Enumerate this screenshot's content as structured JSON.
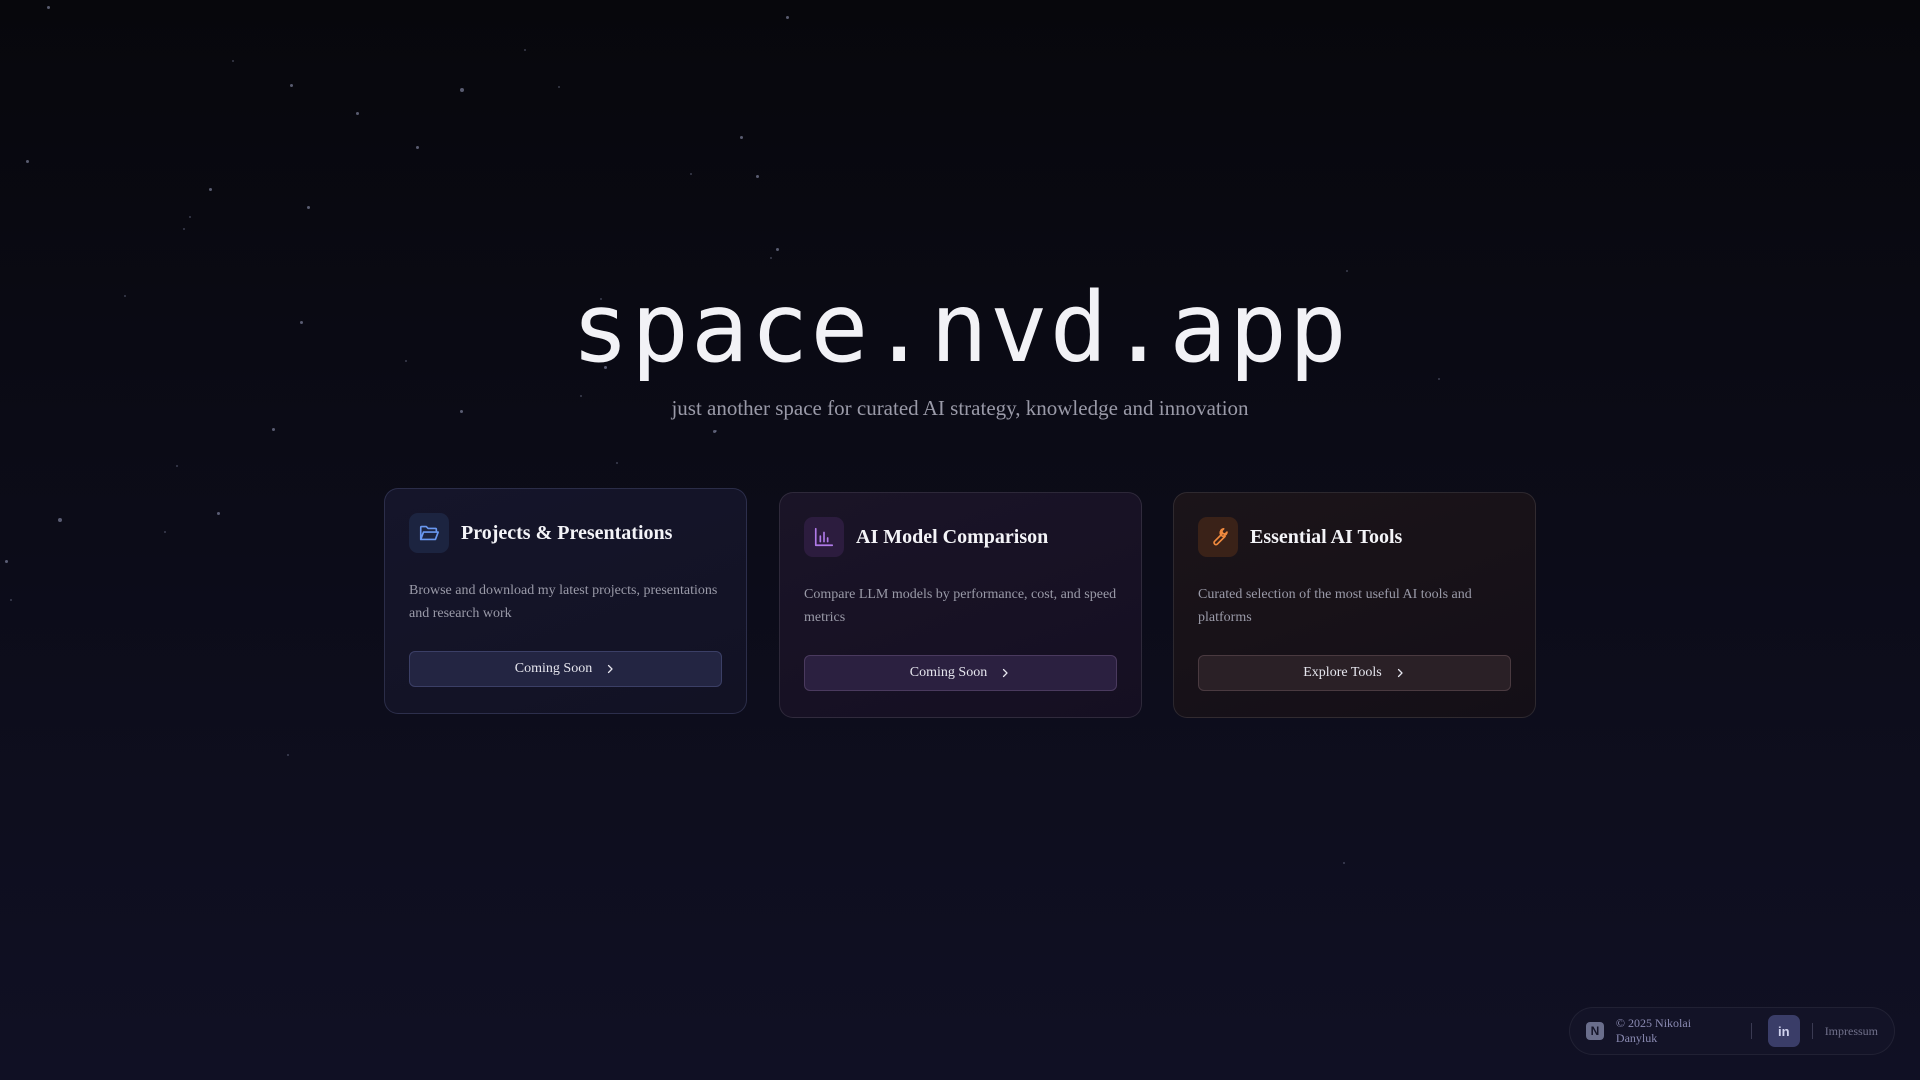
{
  "hero": {
    "title": "space.nvd.app",
    "subtitle": "just another space for curated AI strategy, knowledge and innovation"
  },
  "cards": [
    {
      "title": "Projects & Presentations",
      "description": "Browse and download my latest projects, presentations and research work",
      "button_label": "Coming Soon",
      "icon": "folder-open-icon",
      "accent": "#6a98f0"
    },
    {
      "title": "AI Model Comparison",
      "description": "Compare LLM models by performance, cost, and speed metrics",
      "button_label": "Coming Soon",
      "icon": "bar-chart-icon",
      "accent": "#b07ae8"
    },
    {
      "title": "Essential AI Tools",
      "description": "Curated selection of the most useful AI tools and platforms",
      "button_label": "Explore Tools",
      "icon": "wrench-icon",
      "accent": "#f08a3e"
    }
  ],
  "footer": {
    "logo_letter": "N",
    "copyright": "© 2025 Nikolai Danyluk",
    "linkedin_label": "in",
    "impressum": "Impressum"
  },
  "colors": {
    "background": "#0b0b16",
    "text_primary": "#f2f2f6",
    "text_muted": "#9a9aa8"
  }
}
